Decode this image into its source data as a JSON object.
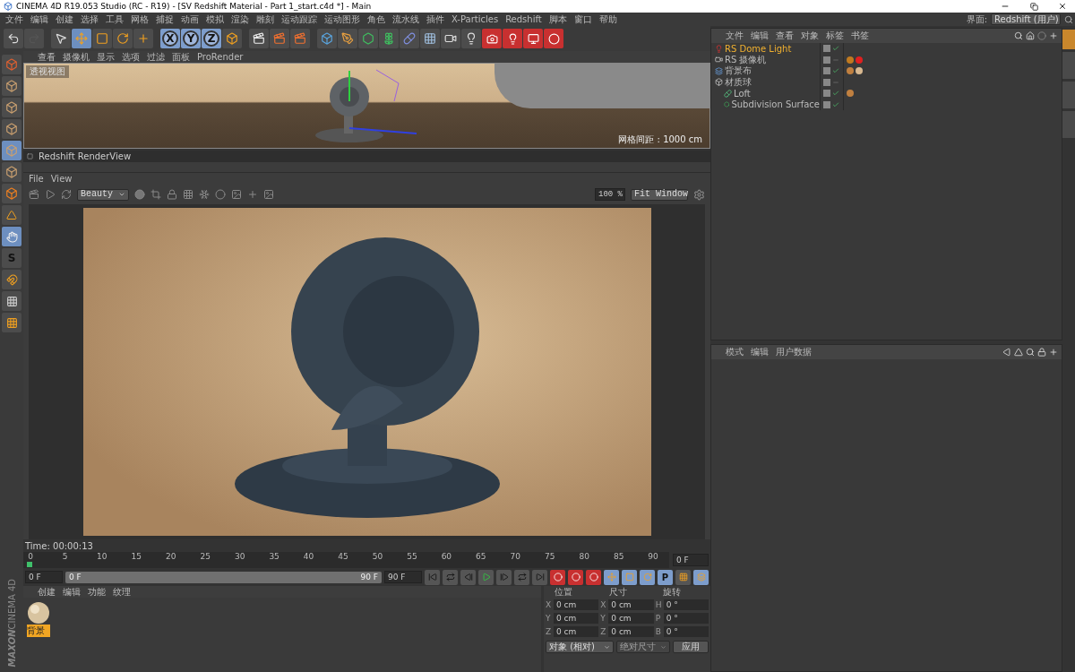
{
  "window": {
    "title": "CINEMA 4D R19.053 Studio (RC - R19) - [SV Redshift Material - Part 1_start.c4d *] - Main"
  },
  "menu": [
    "文件",
    "编辑",
    "创建",
    "选择",
    "工具",
    "网格",
    "捕捉",
    "动画",
    "模拟",
    "渲染",
    "雕刻",
    "运动跟踪",
    "运动图形",
    "角色",
    "流水线",
    "插件",
    "X-Particles",
    "Redshift",
    "脚本",
    "窗口",
    "帮助"
  ],
  "layout": {
    "label": "界面:",
    "value": "Redshift (用户)"
  },
  "toolbar": {
    "axes": [
      {
        "label": "X",
        "on": true
      },
      {
        "label": "Y",
        "on": true
      },
      {
        "label": "Z",
        "on": true
      }
    ]
  },
  "side_toolbar": {
    "snap_label": "S"
  },
  "viewport": {
    "menu": [
      "查看",
      "摄像机",
      "显示",
      "选项",
      "过滤",
      "面板",
      "ProRender"
    ],
    "label": "透视视图",
    "grid": "网格间距 : 1000 cm"
  },
  "render_view": {
    "title": "Redshift RenderView",
    "menu": [
      "File",
      "View"
    ],
    "aov": "Beauty",
    "zoom": "100 %",
    "fit": "Fit Window",
    "time": "Time: 00:00:13"
  },
  "timeline": {
    "ticks": [
      "0",
      "5",
      "10",
      "15",
      "20",
      "25",
      "30",
      "35",
      "40",
      "45",
      "50",
      "55",
      "60",
      "65",
      "70",
      "75",
      "80",
      "85",
      "90"
    ],
    "playhead": {
      "level": 0
    },
    "range": {
      "level": 1
    },
    "end_field": "0 F",
    "start": "0 F",
    "range_start": "0 F",
    "range_end": "90 F",
    "end": "90 F",
    "key_label": "P"
  },
  "materials": {
    "menu": [
      "创建",
      "编辑",
      "功能",
      "纹理"
    ],
    "items": [
      {
        "name": "背景",
        "selected": true
      }
    ]
  },
  "coordinates": {
    "headers": [
      "位置",
      "尺寸",
      "旋转"
    ],
    "rows": [
      {
        "cells": [
          {
            "axis": "X",
            "value": "0 cm"
          },
          {
            "axis": "X",
            "value": "0 cm"
          },
          {
            "axis": "H",
            "value": "0 °"
          }
        ]
      },
      {
        "cells": [
          {
            "axis": "Y",
            "value": "0 cm"
          },
          {
            "axis": "Y",
            "value": "0 cm"
          },
          {
            "axis": "P",
            "value": "0 °"
          }
        ]
      },
      {
        "cells": [
          {
            "axis": "Z",
            "value": "0 cm"
          },
          {
            "axis": "Z",
            "value": "0 cm"
          },
          {
            "axis": "B",
            "value": "0 °"
          }
        ]
      }
    ],
    "mode": "对象 (相对)",
    "size_mode": {
      "label": "绝对尺寸",
      "disabled": true
    },
    "apply": "应用"
  },
  "objects": {
    "menu": [
      "文件",
      "编辑",
      "查看",
      "对象",
      "标签",
      "书签"
    ],
    "items": [
      {
        "name": "RS Dome Light",
        "kind": "light",
        "selected": true,
        "enabled": true
      },
      {
        "name": "RS 摄像机",
        "kind": "camera",
        "selected": false,
        "enabled": false,
        "tags": [
          {
            "kind": "target"
          },
          {
            "kind": "redshift"
          }
        ]
      },
      {
        "name": "背景布",
        "kind": "background",
        "selected": false,
        "enabled": true,
        "tags": [
          {
            "kind": "phong"
          },
          {
            "kind": "material"
          }
        ]
      },
      {
        "name": "材质球",
        "kind": "null",
        "selected": false,
        "enabled": false,
        "children": [
          {
            "name": "Loft",
            "kind": "loft",
            "selected": false,
            "enabled": true,
            "tags": [
              {
                "kind": "phong"
              }
            ]
          },
          {
            "name": "Subdivision Surface",
            "kind": "subdivision",
            "selected": false,
            "enabled": true
          }
        ]
      }
    ]
  },
  "side_tabs": [
    {
      "selected": true
    },
    {
      "selected": false
    },
    {
      "selected": false
    },
    {
      "selected": false
    }
  ],
  "attributes": {
    "menu": [
      "模式",
      "编辑",
      "用户数据"
    ]
  },
  "brand": [
    "MAXON",
    "CINEMA 4D"
  ]
}
